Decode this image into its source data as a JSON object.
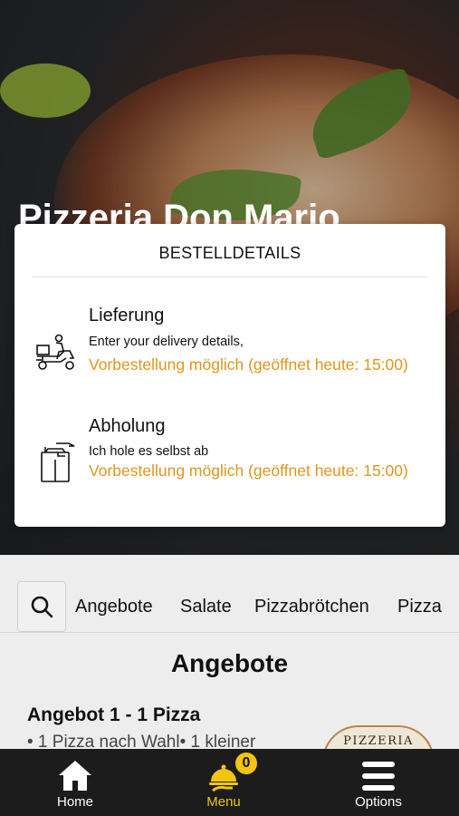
{
  "header": {
    "restaurant_name": "Pizzeria Don Mario"
  },
  "order_modal": {
    "title": "BESTELLDETAILS",
    "options": [
      {
        "icon": "delivery-scooter-icon",
        "title": "Lieferung",
        "subtitle": "Enter your delivery details,",
        "note": "Vorbestellung möglich (geöffnet heute: 15:00)"
      },
      {
        "icon": "takeaway-bag-icon",
        "title": "Abholung",
        "subtitle": "Ich hole es selbst ab",
        "note": "Vorbestellung möglich (geöffnet heute: 15:00)"
      }
    ]
  },
  "categories": {
    "search_icon": "search-icon",
    "items": [
      "Angebote",
      "Salate",
      "Pizzabrötchen",
      "Pizza"
    ]
  },
  "menu_section": {
    "title": "Angebote",
    "product": {
      "title": "Angebot 1 - 1 Pizza",
      "description": "• 1 Pizza nach Wahl• 1 kleiner",
      "logo_text": "PIZZERIA"
    }
  },
  "bottom_nav": {
    "items": [
      {
        "label": "Home",
        "icon": "home-icon"
      },
      {
        "label": "Menu",
        "icon": "cloche-icon",
        "badge": "0"
      },
      {
        "label": "Options",
        "icon": "hamburger-menu-icon"
      }
    ]
  },
  "colors": {
    "accent": "#f2c511",
    "note_orange": "#e0951c",
    "nav_bg": "#1c1c1c"
  }
}
